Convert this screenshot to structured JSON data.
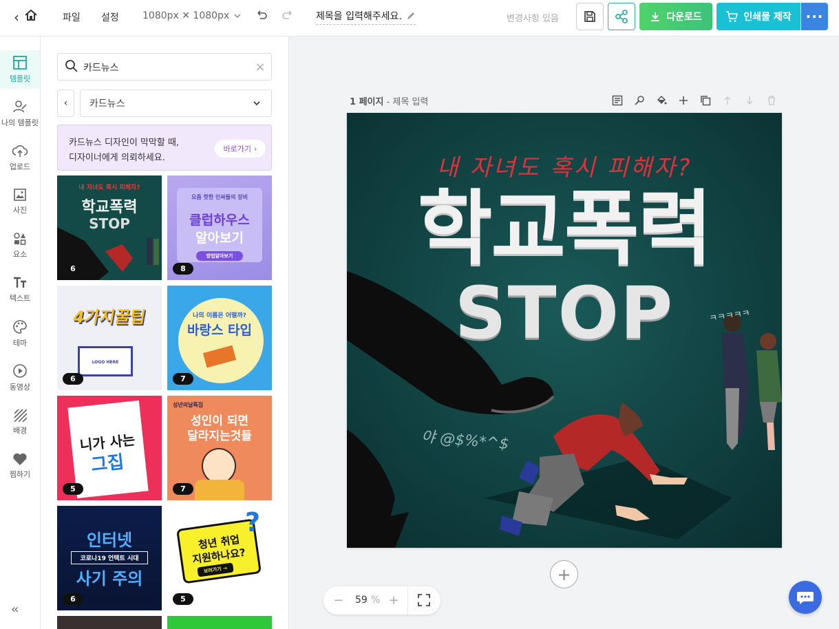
{
  "topbar": {
    "menu_file": "파일",
    "menu_settings": "설정",
    "canvas_size": "1080px ✕ 1080px",
    "document_title": "제목을 입력해주세요.",
    "status": "변경사항 있음",
    "download_label": "다운로드",
    "print_label": "인쇄물 제작",
    "colors": {
      "download": "#3cc37a",
      "print": "#1ac1d5",
      "more": "#3a85e0",
      "share": "#2ab3a4"
    }
  },
  "rail": {
    "items": [
      {
        "label": "템플릿",
        "icon": "layout-icon",
        "active": true
      },
      {
        "label": "나의 템플릿",
        "icon": "user-edit-icon"
      },
      {
        "label": "업로드",
        "icon": "cloud-upload-icon"
      },
      {
        "label": "사진",
        "icon": "image-icon"
      },
      {
        "label": "요소",
        "icon": "shapes-icon"
      },
      {
        "label": "텍스트",
        "icon": "text-icon"
      },
      {
        "label": "테마",
        "icon": "palette-icon"
      },
      {
        "label": "동영상",
        "icon": "play-circle-icon"
      },
      {
        "label": "배경",
        "icon": "hatch-background-icon"
      },
      {
        "label": "찜하기",
        "icon": "heart-icon"
      }
    ]
  },
  "panel": {
    "search_value": "카드뉴스",
    "category_select": "카드뉴스",
    "promo_line1": "카드뉴스 디자인이 막막할 때,",
    "promo_line2": "디자이너에게 의뢰하세요.",
    "promo_button": "바로가기",
    "templates": [
      {
        "count": "6",
        "lines": [
          "내 자녀도 혹시 피해자?",
          "학교폭력",
          "STOP"
        ]
      },
      {
        "count": "8",
        "lines": [
          "요즘 핫한 인싸들의 장비",
          "클럽하우스",
          "알아보기",
          "방법알아보기"
        ]
      },
      {
        "count": "6",
        "lines": [
          "4가지꿀팁",
          "LOGO HERE"
        ]
      },
      {
        "count": "7",
        "lines": [
          "나의 이름은 어떨까?",
          "바랑스 타입"
        ]
      },
      {
        "count": "5",
        "lines": [
          "니가 사는",
          "그집"
        ]
      },
      {
        "count": "7",
        "lines": [
          "성년의날특집",
          "성인이 되면",
          "달라지는것들"
        ]
      },
      {
        "count": "6",
        "lines": [
          "인터넷",
          "코로나19 언택트 시대",
          "사기 주의"
        ]
      },
      {
        "count": "5",
        "lines": [
          "청년 취업",
          "지원하나요?",
          "보러가기 →"
        ]
      }
    ]
  },
  "workspace": {
    "page_number": "1 페이지",
    "page_title_placeholder": "- 제목 입력",
    "zoom_value": "59",
    "zoom_unit": "%"
  },
  "artboard": {
    "headline_script": "내 자녀도 혹시 피해자?",
    "headline_main": "학교폭력",
    "headline_sub": "STOP",
    "graffiti": "야 @$%*^$",
    "whisper": "ㅋㅋㅋㅋㅋ",
    "colors": {
      "background": "#0f4042",
      "script": "#e0303a"
    }
  }
}
